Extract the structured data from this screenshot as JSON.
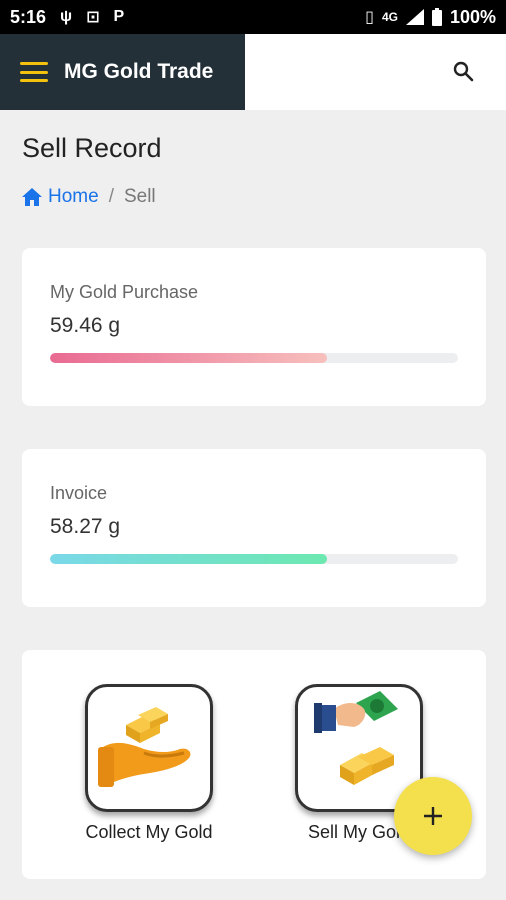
{
  "status_bar": {
    "time": "5:16",
    "network": "4G",
    "battery": "100%"
  },
  "app_bar": {
    "title": "MG Gold Trade",
    "menu_icon": "hamburger-icon",
    "search_icon": "search-icon"
  },
  "page": {
    "title": "Sell Record"
  },
  "breadcrumb": {
    "home": "Home",
    "separator": "/",
    "current": "Sell"
  },
  "stats": [
    {
      "label": "My Gold Purchase",
      "value": "59.46 g",
      "progress": 0.68,
      "color": "#e96a92"
    },
    {
      "label": "Invoice",
      "value": "58.27 g",
      "progress": 0.68,
      "color": "#6ce8b0"
    }
  ],
  "actions": [
    {
      "label": "Collect My Gold",
      "icon": "collect-gold-icon"
    },
    {
      "label": "Sell My Gold",
      "icon": "sell-gold-icon"
    }
  ],
  "fab": {
    "label": "+",
    "icon": "plus-icon"
  },
  "colors": {
    "accent": "#f4c20d",
    "brand_bg": "#233038",
    "link": "#1a73e8",
    "fab": "#f4e04d"
  }
}
